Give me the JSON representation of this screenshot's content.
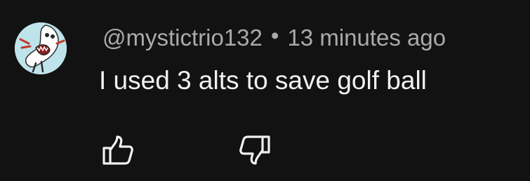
{
  "comment": {
    "author": "@mystictrio132",
    "separator": "•",
    "time": "13 minutes ago",
    "text": "I used 3 alts to save golf ball"
  },
  "icons": {
    "avatar": "avatar-cartoon",
    "like": "thumb-up-icon",
    "dislike": "thumb-down-icon"
  },
  "colors": {
    "background": "#121212",
    "meta_text": "#aaaaaa",
    "body_text": "#f1f1f1",
    "icon": "#f1f1f1"
  }
}
